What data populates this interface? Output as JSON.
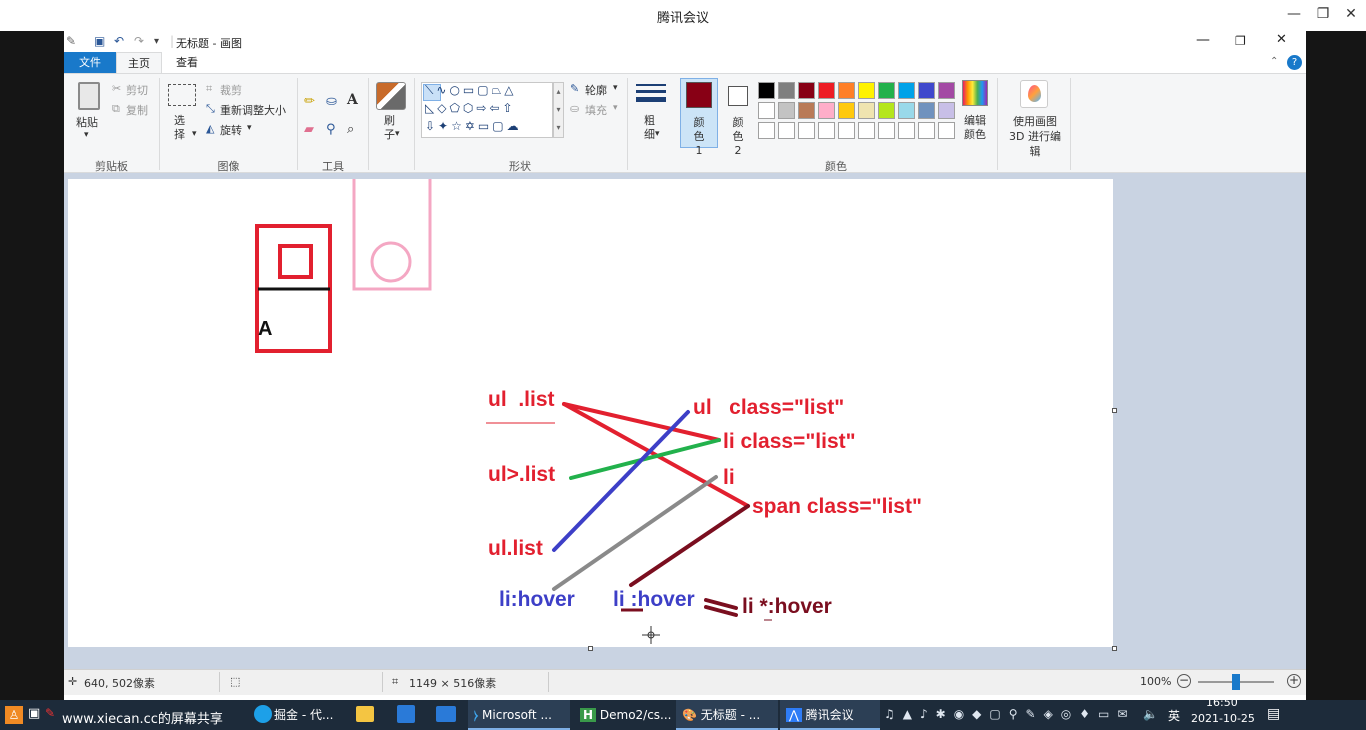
{
  "meeting": {
    "title": "腾讯会议",
    "minimize": "—",
    "restore": "❐",
    "close": "✕"
  },
  "paint": {
    "doc_title": "无标题 - 画图",
    "tabs": [
      "文件",
      "主页",
      "查看"
    ],
    "clipboard": {
      "paste": "粘贴",
      "cut": "剪切",
      "copy": "复制",
      "label": "剪贴板"
    },
    "image": {
      "select": "选择",
      "crop": "裁剪",
      "resize": "重新调整大小",
      "rotate": "旋转",
      "label": "图像"
    },
    "tools_label": "工具",
    "brush": "刷子",
    "shapes": {
      "outline": "轮廓",
      "fill": "填充",
      "label": "形状"
    },
    "size": "粗细",
    "color1": "颜色 1",
    "color2": "颜色 2",
    "edit_colors": "编辑颜色",
    "paint3d": "使用画图 3D 进行编辑",
    "colors_label": "颜色",
    "palette": [
      "#000000",
      "#7f7f7f",
      "#880015",
      "#ed1c24",
      "#ff7f27",
      "#fff200",
      "#22b14c",
      "#00a2e8",
      "#3f48cc",
      "#a349a4",
      "#ffffff",
      "#c3c3c3",
      "#b97a57",
      "#ffaec9",
      "#ffc90e",
      "#efe4b0",
      "#b5e61d",
      "#99d9ea",
      "#7092be",
      "#c8bfe7"
    ]
  },
  "canvas": {
    "box_letter": "A",
    "labels": {
      "ul_list": "ul  .list",
      "ul_gt_list": "ul>.list",
      "ul_dot_list": "ul.list",
      "li_hover": "li:hover",
      "li_sp_hover": "li :hover",
      "li_star_hover": "li *:hover",
      "ul_class": "ul   class=\"list\"",
      "li_class": "li class=\"list\"",
      "li": "li",
      "span_class": "span class=\"list\""
    },
    "colors": {
      "red": "#e2202f",
      "blue": "#3d3fc7",
      "green": "#22b14c",
      "gray": "#8a8a8a",
      "maroon": "#7a0e1f",
      "pink": "#f4a7c3"
    }
  },
  "status": {
    "cursor": "640, 502像素",
    "dims": "1149 × 516像素",
    "zoom": "100%",
    "zoom_level": 0.5
  },
  "taskbar": {
    "share": "www.xiecan.cc的屏幕共享",
    "apps": [
      "掘金 - 代...",
      "Microsoft ...",
      "Demo2/cs...",
      "无标题 - ...",
      "腾讯会议"
    ],
    "ime": "英",
    "time": "16:50",
    "date": "2021-10-25"
  }
}
